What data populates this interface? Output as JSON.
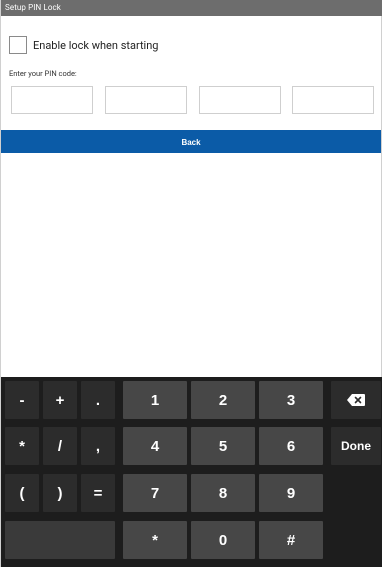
{
  "titlebar": {
    "title": "Setup PIN Lock"
  },
  "lock": {
    "label": "Enable lock when starting",
    "checked": false
  },
  "pin": {
    "label": "Enter your PIN code:",
    "fields": [
      "",
      "",
      "",
      ""
    ]
  },
  "back_button": {
    "label": "Back"
  },
  "keyboard": {
    "row1": [
      "-",
      "+",
      ".",
      "1",
      "2",
      "3"
    ],
    "row2": [
      "*",
      "/",
      ",",
      "4",
      "5",
      "6"
    ],
    "row3": [
      "(",
      ")",
      "=",
      "7",
      "8",
      "9"
    ],
    "row4": [
      "*",
      "0",
      "#"
    ],
    "backspace_icon": "backspace-icon",
    "done_label": "Done"
  },
  "colors": {
    "titlebar": "#6d6d6d",
    "accent": "#0b5ba7",
    "keyboard_bg": "#1d1d1d",
    "key_symbol": "#2c2c2c",
    "key_number": "#474747"
  }
}
